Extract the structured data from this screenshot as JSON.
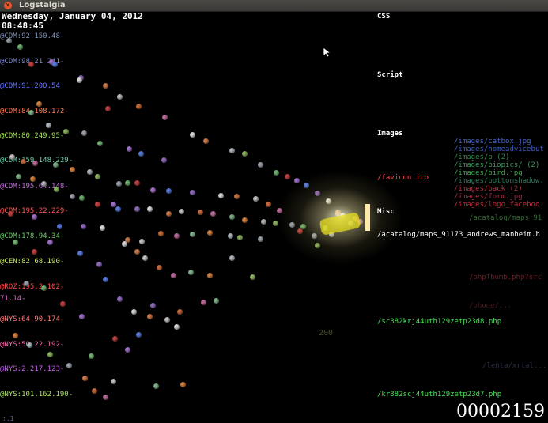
{
  "window": {
    "title": "Logstalgia"
  },
  "clock": {
    "date": "Wednesday, January 04, 2012",
    "time": "08:48:45"
  },
  "hosts": [
    {
      "label": "@CDM:92.150.48-",
      "color": "#7d8fb0"
    },
    {
      "label": "@CDM:98.21 241-",
      "color": "#7a86c8"
    },
    {
      "label": "@CDM:91.200.54",
      "color": "#6a78ff"
    },
    {
      "label": "@CDM:84.108.172-",
      "color": "#ff7c4c"
    },
    {
      "label": "@CDM:80.249.95-",
      "color": "#a4e05a"
    },
    {
      "label": "@CDM:159.148.229-",
      "color": "#66d0a8"
    },
    {
      "label": "@CDM:195.64.148-",
      "color": "#c070d8"
    },
    {
      "label": "@CDM:195.22.229-",
      "color": "#ff5a5a"
    },
    {
      "label": "@CDM:178.94.34-",
      "color": "#6acb6a"
    },
    {
      "label": "@CEN:82.68.190-",
      "color": "#c6e466"
    },
    {
      "label": "@ROZ:195.2.102-",
      "color": "#ff4a4a"
    },
    {
      "label": "71.14-",
      "color": "#e060c8"
    },
    {
      "label": "@NYS:64.90.174-",
      "color": "#ff7a7a"
    },
    {
      "label": "@NYS:50.22.192-",
      "color": "#ff6ab0"
    },
    {
      "label": "@NYS:2.217.123-",
      "color": "#c062e8"
    },
    {
      "label": "@NYS:101.162.190-",
      "color": "#a8e060"
    }
  ],
  "categories": [
    {
      "label": "CSS",
      "color": "#ffffff"
    },
    {
      "label": "Script",
      "color": "#ffffff"
    },
    {
      "label": "Images",
      "color": "#ffffff"
    },
    {
      "label": "Misc",
      "color": "#ffffff"
    }
  ],
  "urls": [
    {
      "label": "/favicon.ico",
      "color": "#ff4d5a"
    },
    {
      "label": "/acatalog/maps_91173_andrews_manheim.h",
      "color": "#ffffff"
    },
    {
      "label": "/sc382krj44uth129zetp23d8.php",
      "color": "#4be05a"
    },
    {
      "label": "/kr382scj44uth129zetp23d7.php",
      "color": "#4be05a"
    }
  ],
  "faint_urls": [
    {
      "label": "/acatalog/maps_91",
      "color": "#2e6b2e"
    },
    {
      "label": "/phpThumb.php?src",
      "color": "#6b1f26"
    },
    {
      "label": "/phone/...",
      "color": "#4d1a22"
    },
    {
      "label": "/lenta/xrtal...",
      "color": "#2a2f4a"
    }
  ],
  "image_files": [
    {
      "label": "/images/catbox.jpg",
      "color": "#4966c8"
    },
    {
      "label": "/images/homeadvicebut",
      "color": "#3f5fc0"
    },
    {
      "label": "/images/p (2)",
      "color": "#2f8a4a"
    },
    {
      "label": "/images/biopics/ (2)",
      "color": "#3a9a5a"
    },
    {
      "label": "/images/bird.jpg",
      "color": "#3aa84a"
    },
    {
      "label": "/images/bottomshadow.",
      "color": "#2f7a5a"
    },
    {
      "label": "/images/back (2)",
      "color": "#b03040"
    },
    {
      "label": "/images/form.jpg",
      "color": "#a03046"
    },
    {
      "label": "/images/logo_faceboo",
      "color": "#c02a3a"
    }
  ],
  "paddle_score": "200",
  "response_counter": "200",
  "total_counter": "00002159",
  "bottom_mark": ":,1",
  "cursor": "pointer-icon"
}
